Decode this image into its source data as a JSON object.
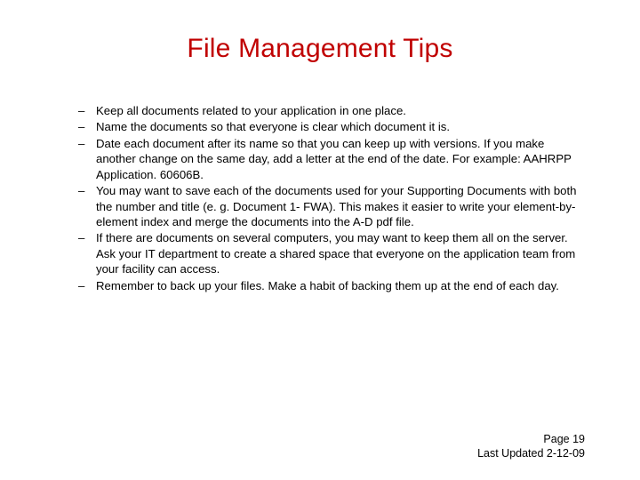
{
  "title": "File Management Tips",
  "bullets": [
    "Keep all documents related to your application in one place.",
    "Name the documents so that everyone is clear which document it is.",
    "Date each document after its name so that you can keep up with versions. If you make another change on the same day, add a letter at the end of the date.  For example:  AAHRPP Application. 60606B.",
    "You may want to save each of the documents used for your Supporting Documents with both the number and title (e. g. Document 1- FWA).  This makes it easier to write your element-by-element index and merge the documents into the A-D pdf file.",
    "If there are documents on several computers, you may want to keep them all on the server.  Ask your IT department to create a shared space that everyone on the application team from your facility can access.",
    "Remember to back up your files.  Make a habit of backing them up at the end of each day."
  ],
  "footer": {
    "page": "Page 19",
    "updated": "Last Updated 2-12-09"
  }
}
